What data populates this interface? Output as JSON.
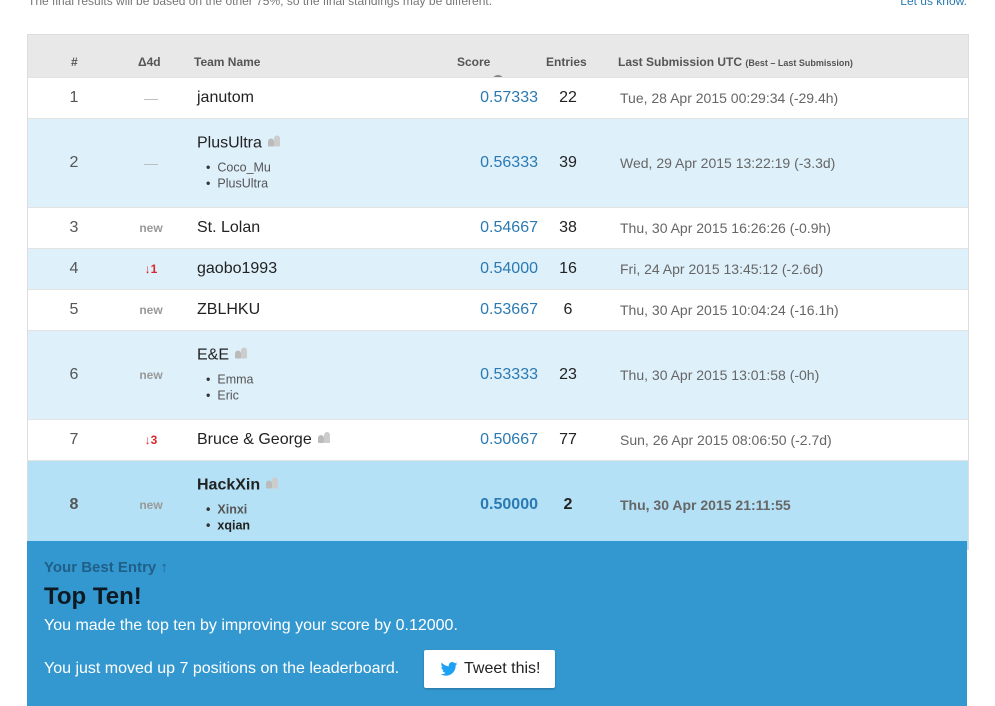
{
  "notice": {
    "text": "The final results will be based on the other 75%, so the final standings may be different.",
    "link": "Let us know."
  },
  "columns": {
    "rank": "#",
    "delta": "Δ4d",
    "team": "Team Name",
    "score": "Score",
    "entries": "Entries",
    "last": "Last Submission UTC",
    "last_note": "(Best – Last Submission)"
  },
  "rows": [
    {
      "rank": "1",
      "delta": "—",
      "team": "janutom",
      "score": "0.57333",
      "entries": "22",
      "last": "Tue, 28 Apr 2015 00:29:34 (-29.4h)"
    },
    {
      "rank": "2",
      "delta": "—",
      "team": "PlusUltra",
      "members": [
        "Coco_Mu",
        "PlusUltra"
      ],
      "score": "0.56333",
      "entries": "39",
      "last": "Wed, 29 Apr 2015 13:22:19 (-3.3d)"
    },
    {
      "rank": "3",
      "delta": "new",
      "team": "St. Lolan",
      "score": "0.54667",
      "entries": "38",
      "last": "Thu, 30 Apr 2015 16:26:26 (-0.9h)"
    },
    {
      "rank": "4",
      "delta": "↓1",
      "team": "gaobo1993",
      "score": "0.54000",
      "entries": "16",
      "last": "Fri, 24 Apr 2015 13:45:12 (-2.6d)"
    },
    {
      "rank": "5",
      "delta": "new",
      "team": "ZBLHKU",
      "score": "0.53667",
      "entries": "6",
      "last": "Thu, 30 Apr 2015 10:04:24 (-16.1h)"
    },
    {
      "rank": "6",
      "delta": "new",
      "team": "E&E",
      "members": [
        "Emma",
        "Eric"
      ],
      "score": "0.53333",
      "entries": "23",
      "last": "Thu, 30 Apr 2015 13:01:58 (-0h)"
    },
    {
      "rank": "7",
      "delta": "↓3",
      "team": "Bruce & George",
      "score": "0.50667",
      "entries": "77",
      "last": "Sun, 26 Apr 2015 08:06:50 (-2.7d)"
    },
    {
      "rank": "8",
      "delta": "new",
      "team": "HackXin",
      "members": [
        "Xinxi",
        "xqian"
      ],
      "score": "0.50000",
      "entries": "2",
      "last": "Thu, 30 Apr 2015 21:11:55"
    }
  ],
  "banner": {
    "kicker": "Your Best Entry ↑",
    "title": "Top Ten!",
    "line1": "You made the top ten by improving your score by 0.12000.",
    "line2": "You just moved up 7 positions on the leaderboard.",
    "tweet": "Tweet this!"
  },
  "colors": {
    "accent": "#2a7ab3",
    "banner": "#3498d0",
    "row_alt": "#def0fa",
    "row_me": "#b4e1f5",
    "down": "#d9282e"
  }
}
